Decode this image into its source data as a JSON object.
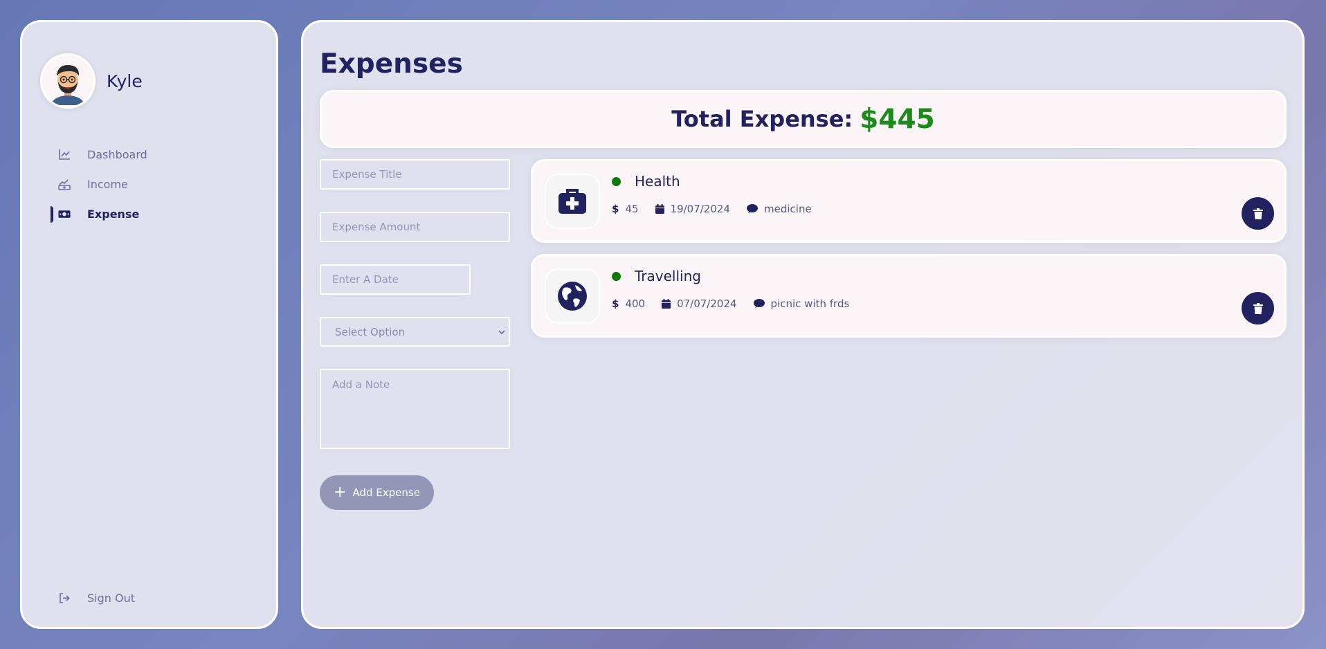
{
  "user": {
    "name": "Kyle"
  },
  "nav": {
    "items": [
      {
        "label": "Dashboard",
        "icon": "chart-line-icon"
      },
      {
        "label": "Income",
        "icon": "money-trend-icon"
      },
      {
        "label": "Expense",
        "icon": "money-bill-icon",
        "active": true
      }
    ],
    "signout_label": "Sign Out"
  },
  "page": {
    "title": "Expenses"
  },
  "total": {
    "label": "Total Expense:",
    "amount": "$445"
  },
  "form": {
    "title_placeholder": "Expense Title",
    "amount_placeholder": "Expense Amount",
    "date_placeholder": "Enter A Date",
    "category_selected": "Select Option",
    "note_placeholder": "Add a Note",
    "submit_label": "Add Expense"
  },
  "expenses": [
    {
      "title": "Health",
      "amount": "45",
      "date": "19/07/2024",
      "note": "medicine",
      "icon": "medkit-icon"
    },
    {
      "title": "Travelling",
      "amount": "400",
      "date": "07/07/2024",
      "note": "picnic with frds",
      "icon": "globe-icon"
    }
  ],
  "colors": {
    "primary": "#222260",
    "accent_green": "#1a8a1a",
    "card_bg": "#fcf5f7",
    "button_muted": "#9496b8"
  }
}
